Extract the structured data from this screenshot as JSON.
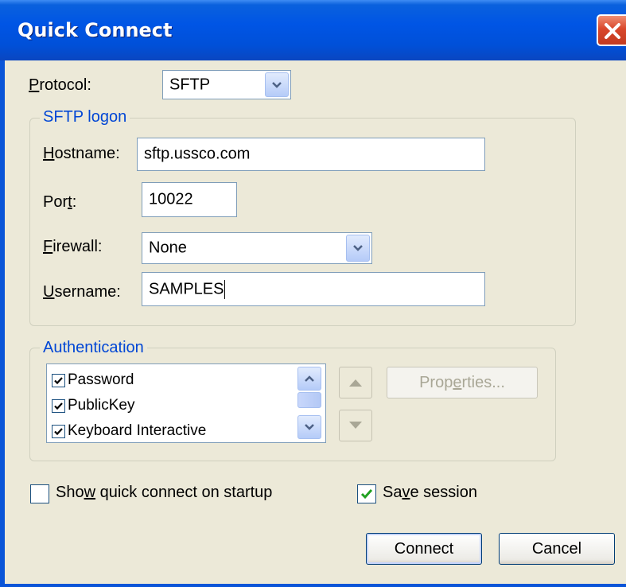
{
  "window": {
    "title": "Quick Connect"
  },
  "protocol": {
    "label": "Protocol:",
    "access_key": "P",
    "label_rest": "rotocol:",
    "value": "SFTP"
  },
  "sftp_logon": {
    "group_title": "SFTP logon",
    "hostname": {
      "label_key": "H",
      "label_rest": "ostname:",
      "value": "sftp.ussco.com"
    },
    "port": {
      "label_pre": "Por",
      "label_key": "t",
      "label_rest": ":",
      "value": "10022"
    },
    "firewall": {
      "label_key": "F",
      "label_rest": "irewall:",
      "value": "None"
    },
    "username": {
      "label_key": "U",
      "label_rest": "sername:",
      "value": "SAMPLES"
    }
  },
  "authentication": {
    "group_title": "Authentication",
    "methods": [
      {
        "label": "Password",
        "checked": true
      },
      {
        "label": "PublicKey",
        "checked": true
      },
      {
        "label": "Keyboard Interactive",
        "checked": true
      }
    ],
    "properties_button": {
      "pre": "Prop",
      "key": "e",
      "rest": "rties..."
    }
  },
  "options": {
    "show_quick_connect": {
      "pre": "Sho",
      "key": "w",
      "rest": " quick connect on startup",
      "checked": false
    },
    "save_session": {
      "pre": "Sa",
      "key": "v",
      "rest": "e session",
      "checked": true
    }
  },
  "buttons": {
    "connect": "Connect",
    "cancel": "Cancel"
  },
  "colors": {
    "title_bar": "#0055e5",
    "group_title": "#0046d5",
    "dialog_bg": "#ece9d8",
    "close_button": "#d9472b"
  }
}
